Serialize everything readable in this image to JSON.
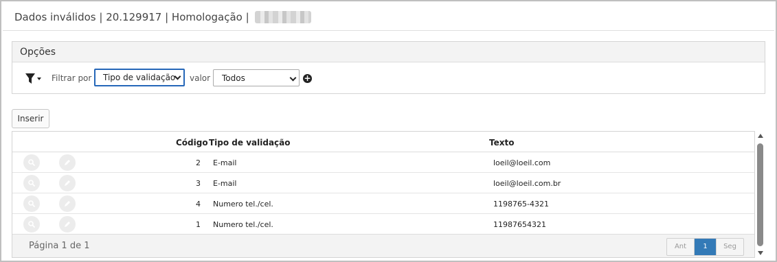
{
  "header": {
    "title": "Dados inválidos | 20.129917 | Homologação |"
  },
  "options": {
    "title": "Opções",
    "filter_label": "Filtrar por",
    "filter_select": "Tipo de validação",
    "value_label": "valor",
    "value_select": "Todos",
    "icons": {
      "filter": "filter-funnel-icon",
      "add": "plus-circle-icon"
    }
  },
  "toolbar": {
    "insert_label": "Inserir"
  },
  "grid": {
    "columns": {
      "code": "Código",
      "type": "Tipo de validação",
      "text": "Texto"
    },
    "rows": [
      {
        "code": "2",
        "type": "E-mail",
        "text": "loeil@loeil.com"
      },
      {
        "code": "3",
        "type": "E-mail",
        "text": "loeil@loeil.com.br"
      },
      {
        "code": "4",
        "type": "Numero tel./cel.",
        "text": "1198765-4321"
      },
      {
        "code": "1",
        "type": "Numero tel./cel.",
        "text": "11987654321"
      }
    ],
    "row_icons": {
      "view": "search-icon",
      "edit": "pencil-icon"
    },
    "footer": {
      "page_info": "Página 1 de 1",
      "prev": "Ant",
      "current_page": "1",
      "next": "Seg"
    }
  },
  "colors": {
    "accent": "#337ab7",
    "focus": "#2466b8"
  }
}
